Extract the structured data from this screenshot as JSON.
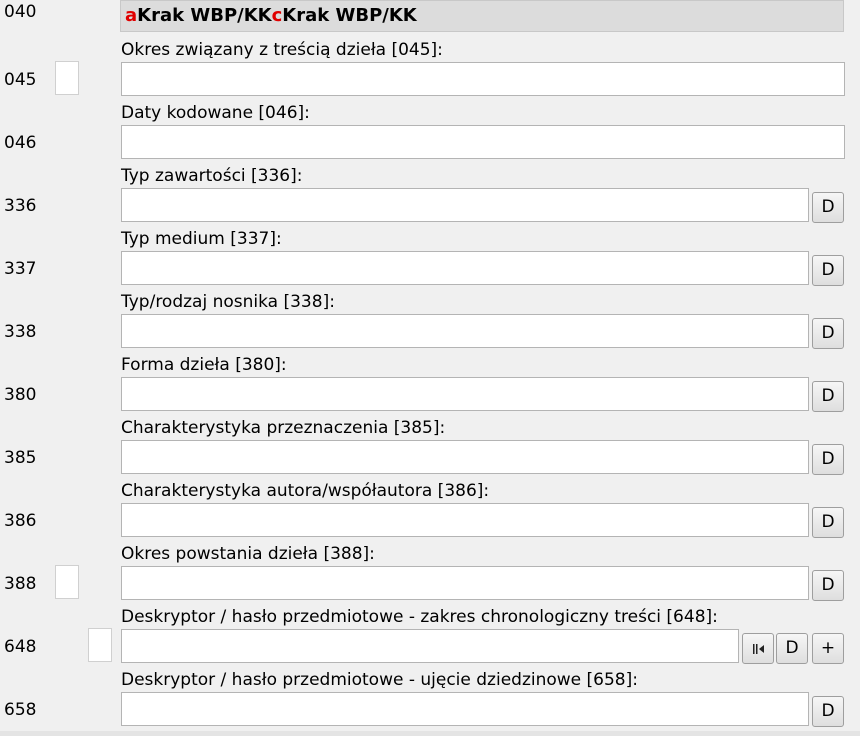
{
  "row_040": {
    "tag": "040",
    "value_parts": [
      {
        "code": "a",
        "text": "Krak WBP/KK"
      },
      {
        "code": "c",
        "text": "Krak WBP/KK"
      }
    ]
  },
  "fields": [
    {
      "tag": "045",
      "label": "Okres związany z treścią dzieła [045]:",
      "value": "",
      "buttons": []
    },
    {
      "tag": "046",
      "label": "Daty kodowane [046]:",
      "value": "",
      "buttons": []
    },
    {
      "tag": "336",
      "label": "Typ zawartości [336]:",
      "value": "",
      "buttons": [
        "D"
      ]
    },
    {
      "tag": "337",
      "label": "Typ medium [337]:",
      "value": "",
      "buttons": [
        "D"
      ]
    },
    {
      "tag": "338",
      "label": "Typ/rodzaj nosnika [338]:",
      "value": "",
      "buttons": [
        "D"
      ]
    },
    {
      "tag": "380",
      "label": "Forma dzieła [380]:",
      "value": "",
      "buttons": [
        "D"
      ]
    },
    {
      "tag": "385",
      "label": "Charakterystyka przeznaczenia [385]:",
      "value": "",
      "buttons": [
        "D"
      ]
    },
    {
      "tag": "386",
      "label": "Charakterystyka autora/współautora [386]:",
      "value": "",
      "buttons": [
        "D"
      ]
    },
    {
      "tag": "388",
      "label": "Okres powstania dzieła [388]:",
      "value": "",
      "buttons": [
        "D"
      ]
    },
    {
      "tag": "648",
      "label": "Deskryptor / hasło przedmiotowe - zakres chronologiczny treści [648]:",
      "value": "",
      "buttons": [
        "picker-icon",
        "D",
        "+"
      ]
    },
    {
      "tag": "658",
      "label": "Deskryptor / hasło przedmiotowe - ujęcie dziedzinowe [658]:",
      "value": "",
      "buttons": [
        "D"
      ]
    }
  ]
}
